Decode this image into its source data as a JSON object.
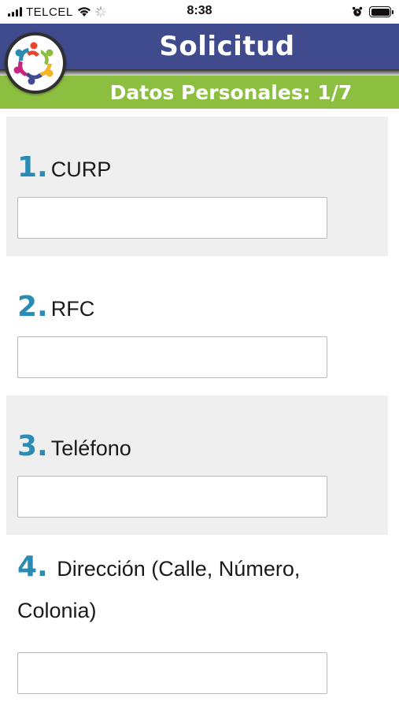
{
  "status_bar": {
    "carrier": "TELCEL",
    "time": "8:38",
    "signal_bars": 4,
    "battery_level": 1.0
  },
  "header": {
    "title": "Solicitud"
  },
  "section": {
    "title": "Datos Personales: 1/7"
  },
  "questions": [
    {
      "number": "1.",
      "label": "CURP",
      "value": "",
      "placeholder": ""
    },
    {
      "number": "2.",
      "label": "RFC",
      "value": "",
      "placeholder": ""
    },
    {
      "number": "3.",
      "label": "Teléfono",
      "value": "",
      "placeholder": ""
    },
    {
      "number": "4.",
      "label": "Dirección (Calle, Número, Colonia)",
      "value": "",
      "placeholder": ""
    }
  ],
  "colors": {
    "header_bg": "#3f4b8c",
    "banner_bg": "#8cbf3f",
    "number_accent": "#2a8cb3",
    "shaded_block": "#efefef"
  }
}
